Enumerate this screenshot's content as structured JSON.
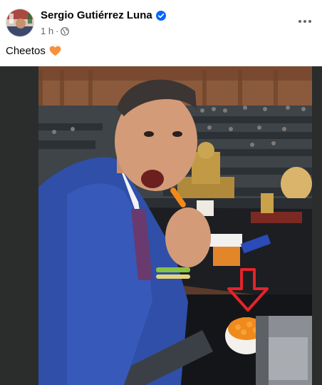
{
  "post": {
    "author": "Sergio Gutiérrez Luna",
    "time": "1 h",
    "separator": "·",
    "caption": "Cheetos",
    "icons": {
      "verified": "verified-badge-icon",
      "audience": "globe-icon",
      "caption_emoji": "orange-heart-icon",
      "more": "more-options-icon"
    }
  },
  "colors": {
    "verified": "#0866ff",
    "meta_text": "#65676b",
    "heart": "#f7913d",
    "arrow": "#e4242b"
  }
}
